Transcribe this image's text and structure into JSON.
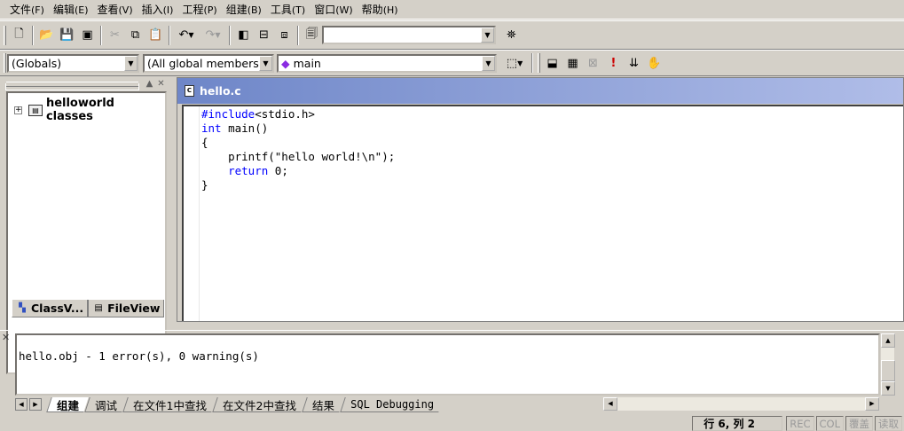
{
  "menu": [
    {
      "label": "文件",
      "key": "(F)"
    },
    {
      "label": "编辑",
      "key": "(E)"
    },
    {
      "label": "查看",
      "key": "(V)"
    },
    {
      "label": "插入",
      "key": "(I)"
    },
    {
      "label": "工程",
      "key": "(P)"
    },
    {
      "label": "组建",
      "key": "(B)"
    },
    {
      "label": "工具",
      "key": "(T)"
    },
    {
      "label": "窗口",
      "key": "(W)"
    },
    {
      "label": "帮助",
      "key": "(H)"
    }
  ],
  "toolbar": {
    "find_combo_value": "",
    "icons": {
      "new": "new-text-file-icon",
      "open": "open-folder-icon",
      "save": "save-icon",
      "save_all": "save-all-icon",
      "cut": "cut-icon",
      "copy": "copy-icon",
      "paste": "paste-icon",
      "undo": "undo-icon",
      "redo": "redo-icon",
      "workspace": "workspace-icon",
      "output": "output-window-icon",
      "window_list": "window-list-icon",
      "find_in_files": "find-in-files-icon",
      "find": "binoculars-icon"
    }
  },
  "wizardbar": {
    "scope": "(Globals)",
    "filter": "(All global members",
    "member": "main"
  },
  "build_toolbar_icons": [
    "compile-icon",
    "build-icon",
    "stop-build-icon",
    "execute-icon",
    "insert-breakpoint-icon",
    "go-icon"
  ],
  "workspace": {
    "tree_root": "helloworld classes",
    "tabs": [
      "ClassV...",
      "FileView"
    ]
  },
  "editor": {
    "title": "hello.c",
    "code_lines": [
      {
        "kw": "#include",
        "rest": "<stdio.h>"
      },
      {
        "kw": "int",
        "rest": " main()"
      },
      {
        "kw": "",
        "rest": "{"
      },
      {
        "kw": "",
        "rest": "    printf(\"hello world!\\n\");",
        "indent_kw": false
      },
      {
        "kw": "",
        "rest": "    return 0;"
      },
      {
        "kw": "",
        "rest": "}"
      }
    ]
  },
  "output": {
    "text": "hello.obj - 1 error(s), 0 warning(s)",
    "tabs": [
      "组建",
      "调试",
      "在文件1中查找",
      "在文件2中查找",
      "结果",
      "SQL Debugging"
    ]
  },
  "status": {
    "position": "行 6, 列 2",
    "indicators": [
      "REC",
      "COL",
      "覆盖",
      "读取"
    ]
  },
  "colors": {
    "keyword": "#0000ff",
    "title_gradient_start": "#6e86c8",
    "title_gradient_end": "#b0bde8",
    "chrome": "#d4d0c8"
  }
}
